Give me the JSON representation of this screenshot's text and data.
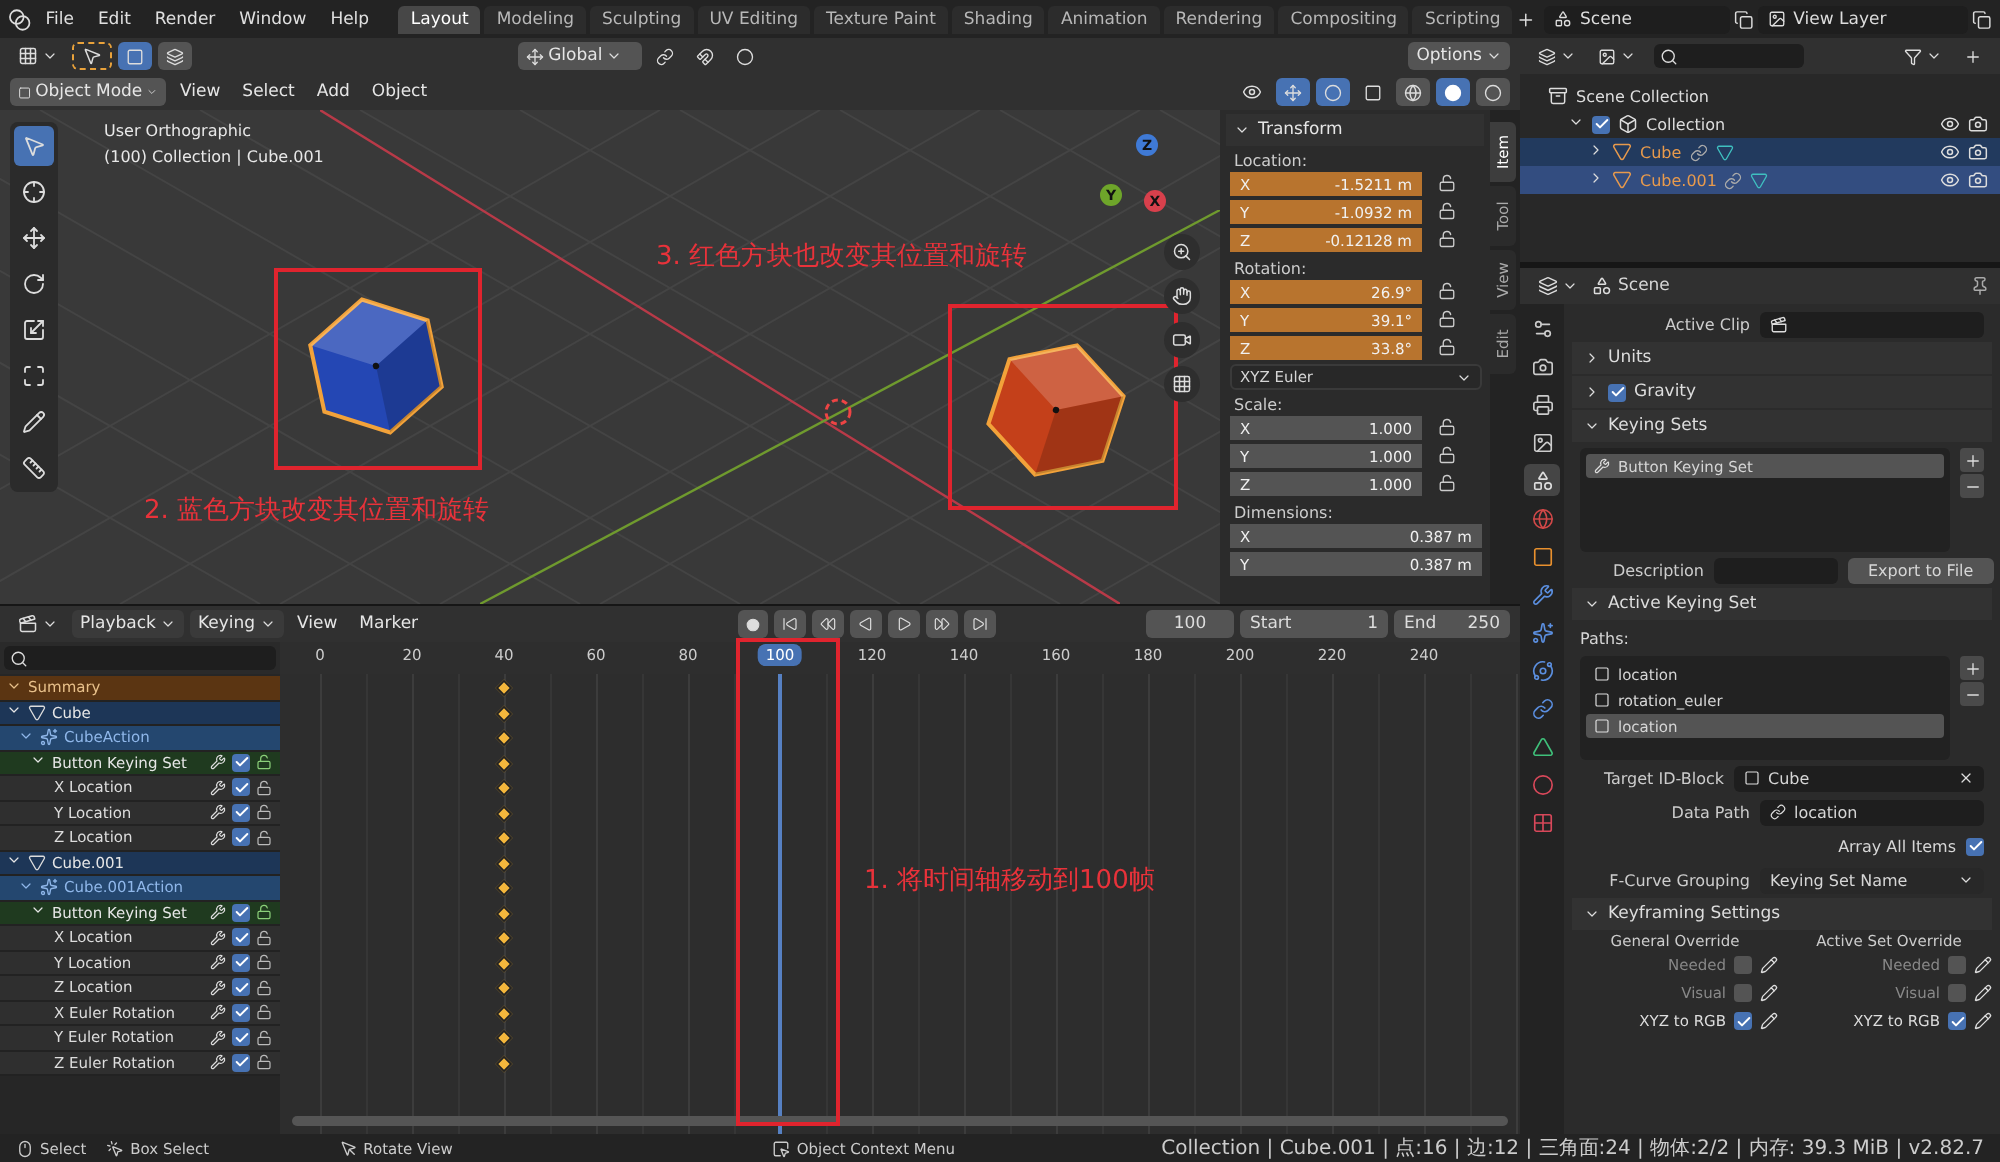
{
  "top_bar": {
    "menus": [
      "File",
      "Edit",
      "Render",
      "Window",
      "Help"
    ],
    "workspaces": [
      {
        "label": "Layout",
        "selected": true
      },
      {
        "label": "Modeling",
        "selected": false
      },
      {
        "label": "Sculpting",
        "selected": false
      },
      {
        "label": "UV Editing",
        "selected": false
      },
      {
        "label": "Texture Paint",
        "selected": false
      },
      {
        "label": "Shading",
        "selected": false
      },
      {
        "label": "Animation",
        "selected": false
      },
      {
        "label": "Rendering",
        "selected": false
      },
      {
        "label": "Compositing",
        "selected": false
      },
      {
        "label": "Scripting",
        "selected": false
      }
    ],
    "scene": "Scene",
    "view_layer": "View Layer"
  },
  "viewport": {
    "orientation": "Global",
    "options": "Options",
    "mode": "Object Mode",
    "menus": [
      "View",
      "Select",
      "Add",
      "Object"
    ],
    "view_name": "User Orthographic",
    "view_info": "(100) Collection | Cube.001",
    "gizmo_axes": [
      {
        "label": "X",
        "color": "#d8404c"
      },
      {
        "label": "Y",
        "color": "#6ea52a"
      },
      {
        "label": "Z",
        "color": "#3f7ad6"
      }
    ],
    "tools": [
      {
        "kind": "select",
        "selected": true
      },
      {
        "kind": "cursor",
        "selected": false
      },
      {
        "kind": "move",
        "selected": false
      },
      {
        "kind": "rotate",
        "selected": false
      },
      {
        "kind": "scale",
        "selected": false
      },
      {
        "kind": "transform",
        "selected": false
      },
      {
        "kind": "annotate",
        "selected": false
      },
      {
        "kind": "measure",
        "selected": false
      }
    ],
    "cubes": [
      {
        "color": "#2447b4",
        "selected": true
      },
      {
        "color": "#c4401a",
        "selected": true
      }
    ],
    "annotations": [
      {
        "text": "3. 红色方块也改变其位置和旋转"
      },
      {
        "text": "2. 蓝色方块改变其位置和旋转"
      }
    ]
  },
  "sidebar": {
    "tabs": [
      {
        "label": "Item",
        "selected": true
      },
      {
        "label": "Tool",
        "selected": false
      },
      {
        "label": "View",
        "selected": false
      },
      {
        "label": "Edit",
        "selected": false
      }
    ],
    "panel": "Transform",
    "groups": [
      {
        "label": "Location:",
        "fields": [
          {
            "axis": "X",
            "value": "-1.5211 m",
            "animated": true,
            "locked": false
          },
          {
            "axis": "Y",
            "value": "-1.0932 m",
            "animated": true,
            "locked": false
          },
          {
            "axis": "Z",
            "value": "-0.12128 m",
            "animated": true,
            "locked": false
          }
        ]
      },
      {
        "label": "Rotation:",
        "fields": [
          {
            "axis": "X",
            "value": "26.9°",
            "animated": true,
            "locked": false
          },
          {
            "axis": "Y",
            "value": "39.1°",
            "animated": true,
            "locked": false
          },
          {
            "axis": "Z",
            "value": "33.8°",
            "animated": true,
            "locked": false
          }
        ],
        "mode": "XYZ Euler"
      },
      {
        "label": "Scale:",
        "fields": [
          {
            "axis": "X",
            "value": "1.000",
            "animated": false,
            "locked": false
          },
          {
            "axis": "Y",
            "value": "1.000",
            "animated": false,
            "locked": false
          },
          {
            "axis": "Z",
            "value": "1.000",
            "animated": false,
            "locked": false
          }
        ]
      },
      {
        "label": "Dimensions:",
        "fields": [
          {
            "axis": "X",
            "value": "0.387 m",
            "animated": false
          },
          {
            "axis": "Y",
            "value": "0.387 m",
            "animated": false
          }
        ]
      }
    ]
  },
  "dope_sheet": {
    "menus": [
      {
        "label": "Playback",
        "dropdown": true
      },
      {
        "label": "Keying",
        "dropdown": true
      },
      {
        "label": "View",
        "dropdown": false
      },
      {
        "label": "Marker",
        "dropdown": false
      }
    ],
    "frame_field": "100",
    "start_label": "Start",
    "start": "1",
    "end_label": "End",
    "end": "250",
    "ruler": [
      "0",
      "20",
      "40",
      "60",
      "80",
      "120",
      "140",
      "160",
      "180",
      "200",
      "220",
      "240"
    ],
    "playhead": "100",
    "channels": [
      {
        "kind": "summary",
        "name": "Summary",
        "expanded": true,
        "keyed": true
      },
      {
        "kind": "object",
        "name": "Cube",
        "expanded": true,
        "keyed": true,
        "children": [
          {
            "kind": "action",
            "name": "CubeAction",
            "expanded": true,
            "keyed": true,
            "children": [
              {
                "kind": "group",
                "name": "Button Keying Set",
                "expanded": true,
                "checked": true,
                "keyed": true,
                "children": [
                  {
                    "kind": "channel",
                    "name": "X Location",
                    "checked": true,
                    "keyed": true
                  },
                  {
                    "kind": "channel",
                    "name": "Y Location",
                    "checked": true,
                    "keyed": true
                  },
                  {
                    "kind": "channel",
                    "name": "Z Location",
                    "checked": true,
                    "keyed": true
                  }
                ]
              }
            ]
          }
        ]
      },
      {
        "kind": "object",
        "name": "Cube.001",
        "expanded": true,
        "keyed": true,
        "children": [
          {
            "kind": "action",
            "name": "Cube.001Action",
            "expanded": true,
            "keyed": true,
            "children": [
              {
                "kind": "group",
                "name": "Button Keying Set",
                "expanded": true,
                "checked": true,
                "keyed": true,
                "children": [
                  {
                    "kind": "channel",
                    "name": "X Location",
                    "checked": true,
                    "keyed": true
                  },
                  {
                    "kind": "channel",
                    "name": "Y Location",
                    "checked": true,
                    "keyed": true
                  },
                  {
                    "kind": "channel",
                    "name": "Z Location",
                    "checked": true,
                    "keyed": true
                  },
                  {
                    "kind": "channel",
                    "name": "X Euler Rotation",
                    "checked": true,
                    "keyed": true
                  },
                  {
                    "kind": "channel",
                    "name": "Y Euler Rotation",
                    "checked": true,
                    "keyed": true
                  },
                  {
                    "kind": "channel",
                    "name": "Z Euler Rotation",
                    "checked": true,
                    "keyed": true
                  }
                ]
              }
            ]
          }
        ]
      }
    ],
    "annotation": "1. 将时间轴移动到100帧"
  },
  "outliner": {
    "items": [
      {
        "name": "Scene Collection",
        "kind": "scene_collection",
        "selected": false,
        "children": [
          {
            "name": "Collection",
            "kind": "collection",
            "checked": true,
            "expanded": true,
            "selected": false,
            "children": [
              {
                "name": "Cube",
                "kind": "object",
                "expanded": false,
                "selected": true
              },
              {
                "name": "Cube.001",
                "kind": "object",
                "expanded": false,
                "selected": true,
                "active": true
              }
            ]
          }
        ]
      }
    ]
  },
  "properties": {
    "context": "Scene",
    "tabs": [
      {
        "kind": "tool",
        "selected": false
      },
      {
        "kind": "render",
        "selected": false
      },
      {
        "kind": "output",
        "selected": false
      },
      {
        "kind": "view_layer",
        "selected": false
      },
      {
        "kind": "scene",
        "selected": true
      },
      {
        "kind": "world",
        "selected": false
      },
      {
        "kind": "object",
        "selected": false
      },
      {
        "kind": "modifier",
        "selected": false
      },
      {
        "kind": "particles",
        "selected": false
      },
      {
        "kind": "physics",
        "selected": false
      },
      {
        "kind": "constraints",
        "selected": false
      },
      {
        "kind": "data",
        "selected": false
      },
      {
        "kind": "material",
        "selected": false
      },
      {
        "kind": "texture",
        "selected": false
      }
    ],
    "active_clip_label": "Active Clip",
    "panels": [
      {
        "title": "Units",
        "expanded": false
      },
      {
        "title": "Gravity",
        "expanded": false,
        "checked": true
      },
      {
        "title": "Keying Sets",
        "expanded": true
      }
    ],
    "keying_sets": [
      {
        "name": "Button Keying Set",
        "selected": true
      }
    ],
    "description_label": "Description",
    "export_button": "Export to File",
    "active_keying_set": {
      "title": "Active Keying Set",
      "expanded": true,
      "paths_label": "Paths:",
      "paths": [
        {
          "name": "location",
          "selected": false
        },
        {
          "name": "rotation_euler",
          "selected": false
        },
        {
          "name": "location",
          "selected": true
        }
      ],
      "target_label": "Target ID-Block",
      "target": "Cube",
      "data_path_label": "Data Path",
      "data_path": "location",
      "array_all_label": "Array All Items",
      "array_all": true,
      "grouping_label": "F-Curve Grouping",
      "grouping": "Keying Set Name"
    },
    "keyframing": {
      "title": "Keyframing Settings",
      "expanded": true,
      "columns": [
        {
          "title": "General Override",
          "options": [
            {
              "label": "Needed",
              "checked": false
            },
            {
              "label": "Visual",
              "checked": false
            },
            {
              "label": "XYZ to RGB",
              "checked": true
            }
          ]
        },
        {
          "title": "Active Set Override",
          "options": [
            {
              "label": "Needed",
              "checked": false
            },
            {
              "label": "Visual",
              "checked": false
            },
            {
              "label": "XYZ to RGB",
              "checked": true
            }
          ]
        }
      ]
    }
  },
  "status_bar": {
    "hints": [
      {
        "kind": "mouse_left",
        "label": "Select"
      },
      {
        "kind": "mouse_drag",
        "label": "Box Select"
      },
      {
        "kind": "mouse_middle",
        "label": "Rotate View"
      },
      {
        "kind": "mouse_right",
        "label": "Object Context Menu"
      }
    ],
    "stats": "Collection | Cube.001 | 点:16 | 边:12 | 三角面:24 | 物体:2/2 | 内存: 39.3 MiB | v2.82.7"
  }
}
